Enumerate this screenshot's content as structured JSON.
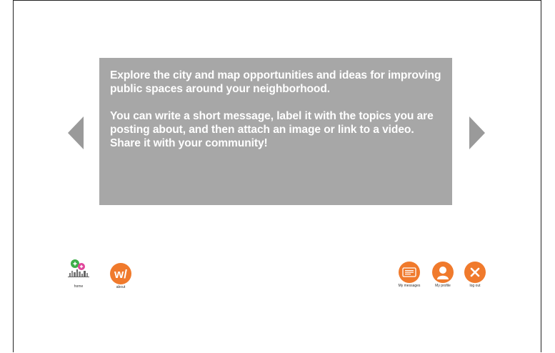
{
  "intro": {
    "paragraph1": "Explore the city and map opportunities and ideas for improving public spaces around your neighborhood.",
    "paragraph2": "You can write a short message, label it with the topics you are posting about, and then attach an image or link to a video. Share it with your community!"
  },
  "nav": {
    "home_label": "home",
    "about_label": "about",
    "messages_label": "My messages",
    "profile_label": "My profile",
    "logout_label": "log out"
  },
  "colors": {
    "panel": "#a7a7a7",
    "accent_orange": "#f07a2c",
    "arrow_gray": "#9a9a9a"
  },
  "icons": {
    "prev": "chevron-left-icon",
    "next": "chevron-right-icon",
    "home": "home-logo-icon",
    "about": "about-w-icon",
    "messages": "messages-icon",
    "profile": "profile-icon",
    "logout": "close-icon"
  }
}
